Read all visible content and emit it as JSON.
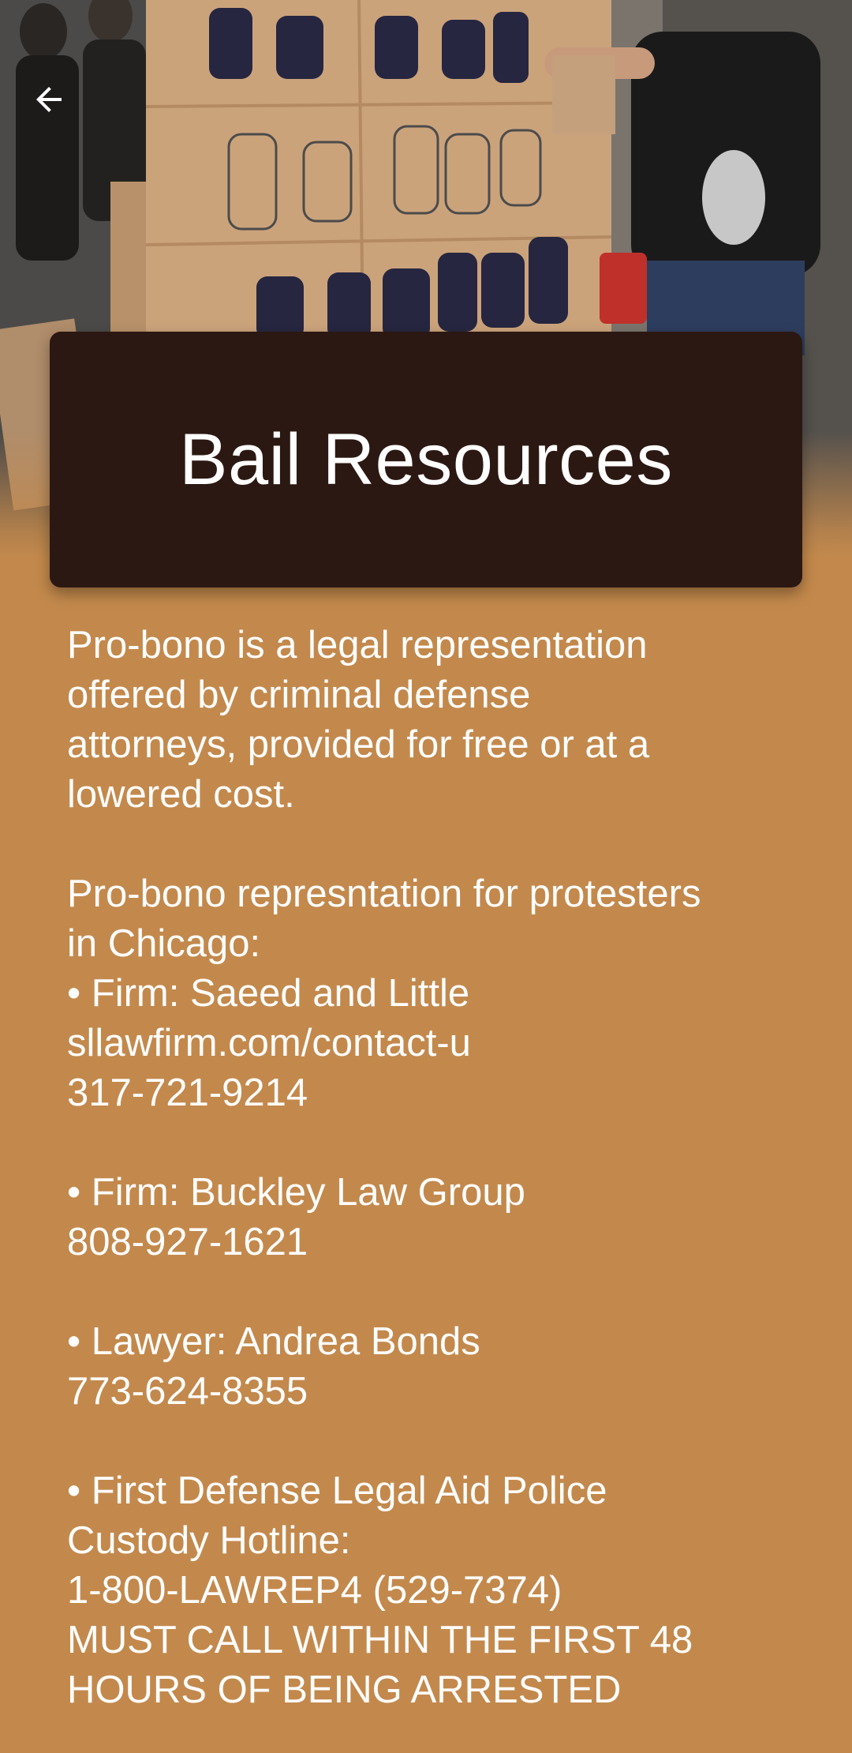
{
  "header": {
    "back_icon": "arrow-back-icon",
    "title": "Bail Resources"
  },
  "colors": {
    "background": "#c3894c",
    "title_card": "#2c1812",
    "text": "#ffffff"
  },
  "body": {
    "intro": [
      "Pro-bono is a legal representation",
      "offered by criminal defense",
      "attorneys, provided for free or at a",
      "lowered cost."
    ],
    "section_heading": [
      "Pro-bono represntation for protesters",
      "in Chicago:"
    ],
    "entries": [
      {
        "name": "• Firm: Saeed and Little",
        "website": "sllawfirm.com/contact-u",
        "phone": "317-721-9214"
      },
      {
        "name": "• Firm: Buckley Law Group",
        "phone": "808-927-1621"
      },
      {
        "name": "• Lawyer: Andrea Bonds",
        "phone": "773-624-8355"
      }
    ],
    "hotline": {
      "name_line1": "• First Defense Legal Aid Police",
      "name_line2": "Custody Hotline:",
      "phone": "1-800-LAWREP4 (529-7374)",
      "warning_line1": "MUST CALL WITHIN THE FIRST 48",
      "warning_line2": "HOURS OF BEING ARRESTED"
    }
  }
}
